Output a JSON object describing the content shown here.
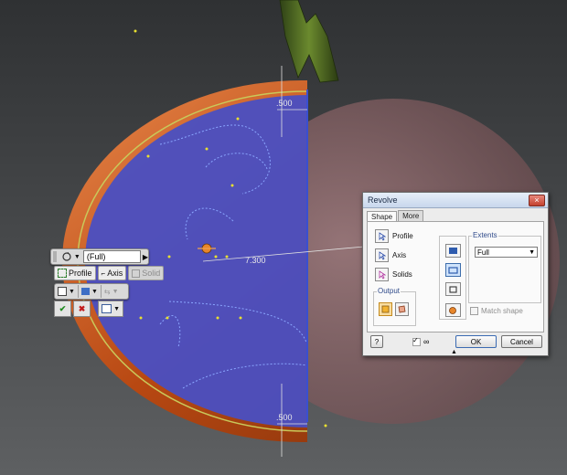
{
  "viewport": {
    "dimension_top": ".500",
    "dimension_bottom": ".500",
    "dimension_horizontal": "7.300"
  },
  "mini_toolbar": {
    "mode_value": "(Full)",
    "profile_label": "Profile",
    "axis_label": "Axis",
    "solid_label": "Solid"
  },
  "dialog": {
    "title": "Revolve",
    "close_glyph": "×",
    "tabs": [
      {
        "label": "Shape"
      },
      {
        "label": "More"
      }
    ],
    "selectors": [
      {
        "label": "Profile"
      },
      {
        "label": "Axis"
      },
      {
        "label": "Solids"
      }
    ],
    "output_label": "Output",
    "extents_label": "Extents",
    "extents_value": "Full",
    "match_shape_label": "Match shape",
    "ok_label": "OK",
    "cancel_label": "Cancel",
    "help_glyph": "?",
    "expand_glyph": "▲"
  },
  "colors": {
    "profile_fill": "#4a4fc2",
    "rim": "#c8561a",
    "preview_ghost": "#8b5f62",
    "dialog_bg": "#ececec"
  }
}
